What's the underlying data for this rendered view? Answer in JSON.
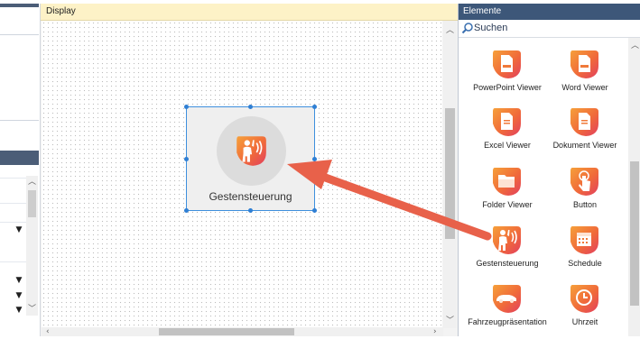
{
  "display_panel": {
    "title": "Display"
  },
  "canvas_control": {
    "label": "Gestensteuerung",
    "icon": "gesture-hand-icon"
  },
  "elements_panel": {
    "title": "Elemente",
    "search_placeholder": "Suchen",
    "items": [
      {
        "label": "PowerPoint Viewer",
        "icon": "powerpoint-file-icon"
      },
      {
        "label": "Word Viewer",
        "icon": "word-file-icon"
      },
      {
        "label": "Excel Viewer",
        "icon": "excel-file-icon"
      },
      {
        "label": "Dokument Viewer",
        "icon": "document-file-icon"
      },
      {
        "label": "Folder Viewer",
        "icon": "folder-icon"
      },
      {
        "label": "Button",
        "icon": "touch-button-icon"
      },
      {
        "label": "Gestensteuerung",
        "icon": "gesture-hand-icon"
      },
      {
        "label": "Schedule",
        "icon": "calendar-icon"
      },
      {
        "label": "Fahrzeugpräsentation",
        "icon": "car-icon"
      },
      {
        "label": "Uhrzeit",
        "icon": "clock-icon"
      }
    ]
  },
  "colors": {
    "accent_orange": "#f2793a",
    "accent_red": "#e8455a",
    "arrow": "#e8614a",
    "selection": "#3e8fdd",
    "panel_header": "#3d5779",
    "display_title_bg": "#fdf2c7"
  }
}
